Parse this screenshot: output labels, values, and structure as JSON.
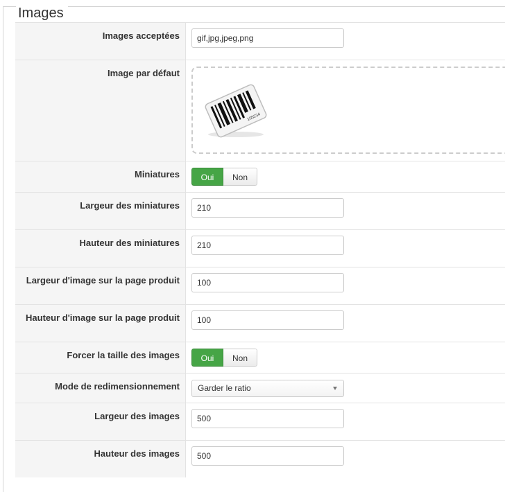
{
  "section": {
    "title": "Images"
  },
  "rows": {
    "accepted": {
      "label": "Images acceptées",
      "value": "gif,jpg,jpeg,png"
    },
    "default_image": {
      "label": "Image par défaut",
      "barcode_text": "105234"
    },
    "thumbnails": {
      "label": "Miniatures",
      "yes": "Oui",
      "no": "Non",
      "selected": "Oui"
    },
    "thumb_width": {
      "label": "Largeur des miniatures",
      "value": "210"
    },
    "thumb_height": {
      "label": "Hauteur des miniatures",
      "value": "210"
    },
    "product_width": {
      "label": "Largeur d'image sur la page produit",
      "value": "100"
    },
    "product_height": {
      "label": "Hauteur d'image sur la page produit",
      "value": "100"
    },
    "force_size": {
      "label": "Forcer la taille des images",
      "yes": "Oui",
      "no": "Non",
      "selected": "Oui"
    },
    "resize_mode": {
      "label": "Mode de redimensionnement",
      "value": "Garder le ratio"
    },
    "image_width": {
      "label": "Largeur des images",
      "value": "500"
    },
    "image_height": {
      "label": "Hauteur des images",
      "value": "500"
    }
  },
  "colors": {
    "toggle_on": "#46a546",
    "label_bg": "#f5f5f5",
    "border": "#e3e3e3"
  },
  "icons": {
    "default_image": "barcode-icon"
  }
}
